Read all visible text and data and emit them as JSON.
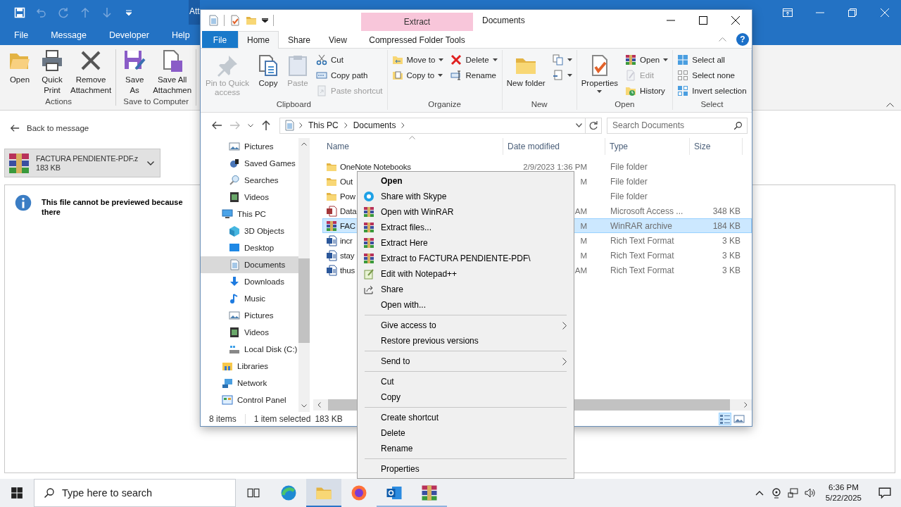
{
  "outlook": {
    "contextual_tab": "Att",
    "menu_tabs": [
      "File",
      "Message",
      "Developer",
      "Help"
    ],
    "ribbon_groups": [
      {
        "label": "Actions",
        "buttons": [
          "Open",
          "Quick Print",
          "Remove Attachment"
        ]
      },
      {
        "label": "Save to Computer",
        "buttons": [
          "Save As",
          "Save All Attachmen"
        ]
      }
    ],
    "back_link": "Back to message",
    "attachment": {
      "name": "FACTURA PENDIENTE-PDF.z",
      "size": "183 KB"
    },
    "preview_message": "This file cannot be previewed because there"
  },
  "explorer": {
    "contextual_group": "Extract",
    "title": "Documents",
    "tabs": [
      {
        "label": "File",
        "kind": "file",
        "selected": false
      },
      {
        "label": "Home",
        "kind": "tab",
        "selected": true
      },
      {
        "label": "Share",
        "kind": "tab",
        "selected": false
      },
      {
        "label": "View",
        "kind": "tab",
        "selected": false
      },
      {
        "label": "Compressed Folder Tools",
        "kind": "contextual",
        "selected": false
      }
    ],
    "help_button": "?",
    "ribbon_groups": [
      {
        "label": "Clipboard",
        "items": [
          {
            "kind": "large",
            "label": "Pin to Quick access",
            "disabled": true,
            "dropdown": false
          },
          {
            "kind": "large",
            "label": "Copy",
            "disabled": false,
            "dropdown": false
          },
          {
            "kind": "large",
            "label": "Paste",
            "disabled": true,
            "dropdown": false
          },
          {
            "kind": "stack",
            "buttons": [
              {
                "label": "Cut",
                "disabled": false,
                "dropdown": false
              },
              {
                "label": "Copy path",
                "disabled": false,
                "dropdown": false
              },
              {
                "label": "Paste shortcut",
                "disabled": true,
                "dropdown": false
              }
            ]
          }
        ]
      },
      {
        "label": "Organize",
        "items": [
          {
            "kind": "stack",
            "buttons": [
              {
                "label": "Move to",
                "disabled": false,
                "dropdown": true
              },
              {
                "label": "Copy to",
                "disabled": false,
                "dropdown": true
              }
            ]
          },
          {
            "kind": "stack",
            "buttons": [
              {
                "label": "Delete",
                "disabled": false,
                "dropdown": true
              },
              {
                "label": "Rename",
                "disabled": false,
                "dropdown": false
              }
            ]
          }
        ]
      },
      {
        "label": "New",
        "items": [
          {
            "kind": "large",
            "label": "New folder",
            "disabled": false,
            "dropdown": false
          },
          {
            "kind": "stack",
            "buttons": [
              {
                "disabled": false,
                "dropdown": true
              },
              {
                "disabled": false,
                "dropdown": true
              }
            ]
          }
        ]
      },
      {
        "label": "Open",
        "items": [
          {
            "kind": "large",
            "label": "Properties",
            "disabled": false,
            "dropdown": true
          },
          {
            "kind": "stack",
            "buttons": [
              {
                "label": "Open",
                "disabled": false,
                "dropdown": true
              },
              {
                "label": "Edit",
                "disabled": true,
                "dropdown": false
              },
              {
                "label": "History",
                "disabled": false,
                "dropdown": false
              }
            ]
          }
        ]
      },
      {
        "label": "Select",
        "items": [
          {
            "kind": "stack",
            "buttons": [
              {
                "label": "Select all",
                "disabled": false,
                "dropdown": false
              },
              {
                "label": "Select none",
                "disabled": false,
                "dropdown": false
              },
              {
                "label": "Invert selection",
                "disabled": false,
                "dropdown": false
              }
            ]
          }
        ]
      }
    ],
    "breadcrumb": [
      "This PC",
      "Documents"
    ],
    "search": {
      "placeholder": "Search Documents"
    },
    "nav_above": [
      {
        "label": "Pictures",
        "selected": false
      },
      {
        "label": "Saved Games",
        "selected": false
      },
      {
        "label": "Searches",
        "selected": false
      },
      {
        "label": "Videos",
        "selected": false
      }
    ],
    "nav_tree": [
      {
        "label": "This PC",
        "selected": false,
        "children": [
          {
            "label": "3D Objects",
            "selected": false
          },
          {
            "label": "Desktop",
            "selected": false
          },
          {
            "label": "Documents",
            "selected": true
          },
          {
            "label": "Downloads",
            "selected": false
          },
          {
            "label": "Music",
            "selected": false
          },
          {
            "label": "Pictures",
            "selected": false
          },
          {
            "label": "Videos",
            "selected": false
          },
          {
            "label": "Local Disk (C:)",
            "selected": false
          }
        ]
      },
      {
        "label": "Libraries",
        "selected": false
      },
      {
        "label": "Network",
        "selected": false
      },
      {
        "label": "Control Panel",
        "selected": false
      }
    ],
    "columns": [
      "Name",
      "Date modified",
      "Type",
      "Size"
    ],
    "files": [
      {
        "name": "OneNote Notebooks",
        "modified": "2/9/2023 1:36 PM",
        "type": "File folder",
        "selected": false
      },
      {
        "name": "Out",
        "modified": "M",
        "type": "File folder",
        "selected": false
      },
      {
        "name": "Pow",
        "type": "File folder",
        "selected": false
      },
      {
        "name": "Data",
        "modified": "AM",
        "type": "Microsoft Access ...",
        "size": "348 KB",
        "selected": false
      },
      {
        "name": "FAC",
        "modified": "M",
        "type": "WinRAR archive",
        "size": "184 KB",
        "selected": true
      },
      {
        "name": "incr",
        "modified": "M",
        "type": "Rich Text Format",
        "size": "3 KB",
        "selected": false
      },
      {
        "name": "stay",
        "modified": "M",
        "type": "Rich Text Format",
        "size": "3 KB",
        "selected": false
      },
      {
        "name": "thus",
        "modified": "AM",
        "type": "Rich Text Format",
        "size": "3 KB",
        "selected": false
      }
    ],
    "status": {
      "item_count": "8 items",
      "selection": "1 item selected",
      "selection_size": "183 KB"
    }
  },
  "context_menu": {
    "groups": [
      {
        "items": [
          {
            "label": "Open",
            "default": true,
            "submenu": false
          },
          {
            "label": "Share with Skype",
            "default": false,
            "submenu": false
          },
          {
            "label": "Open with WinRAR",
            "default": false,
            "submenu": false
          },
          {
            "label": "Extract files...",
            "default": false,
            "submenu": false
          },
          {
            "label": "Extract Here",
            "default": false,
            "submenu": false
          },
          {
            "label": "Extract to FACTURA PENDIENTE-PDF\\",
            "default": false,
            "submenu": false
          },
          {
            "label": "Edit with Notepad++",
            "default": false,
            "submenu": false
          },
          {
            "label": "Share",
            "default": false,
            "submenu": false
          },
          {
            "label": "Open with...",
            "default": false,
            "submenu": false
          }
        ]
      },
      {
        "items": [
          {
            "label": "Give access to",
            "default": false,
            "submenu": true
          },
          {
            "label": "Restore previous versions",
            "default": false,
            "submenu": false
          }
        ]
      },
      {
        "items": [
          {
            "label": "Send to",
            "default": false,
            "submenu": true
          }
        ]
      },
      {
        "items": [
          {
            "label": "Cut",
            "default": false,
            "submenu": false
          },
          {
            "label": "Copy",
            "default": false,
            "submenu": false
          }
        ]
      },
      {
        "items": [
          {
            "label": "Create shortcut",
            "default": false,
            "submenu": false
          },
          {
            "label": "Delete",
            "default": false,
            "submenu": false
          },
          {
            "label": "Rename",
            "default": false,
            "submenu": false
          }
        ]
      },
      {
        "items": [
          {
            "label": "Properties",
            "default": false,
            "submenu": false
          }
        ]
      }
    ]
  },
  "taskbar": {
    "search": {
      "placeholder": "Type here to search"
    },
    "apps": [
      {
        "active": false,
        "running": false
      },
      {
        "active": true,
        "running": true
      },
      {
        "active": false,
        "running": false
      },
      {
        "active": false,
        "running": true
      },
      {
        "active": false,
        "running": true
      }
    ],
    "clock": {
      "time": "6:36 PM",
      "date": "5/22/2025"
    }
  }
}
